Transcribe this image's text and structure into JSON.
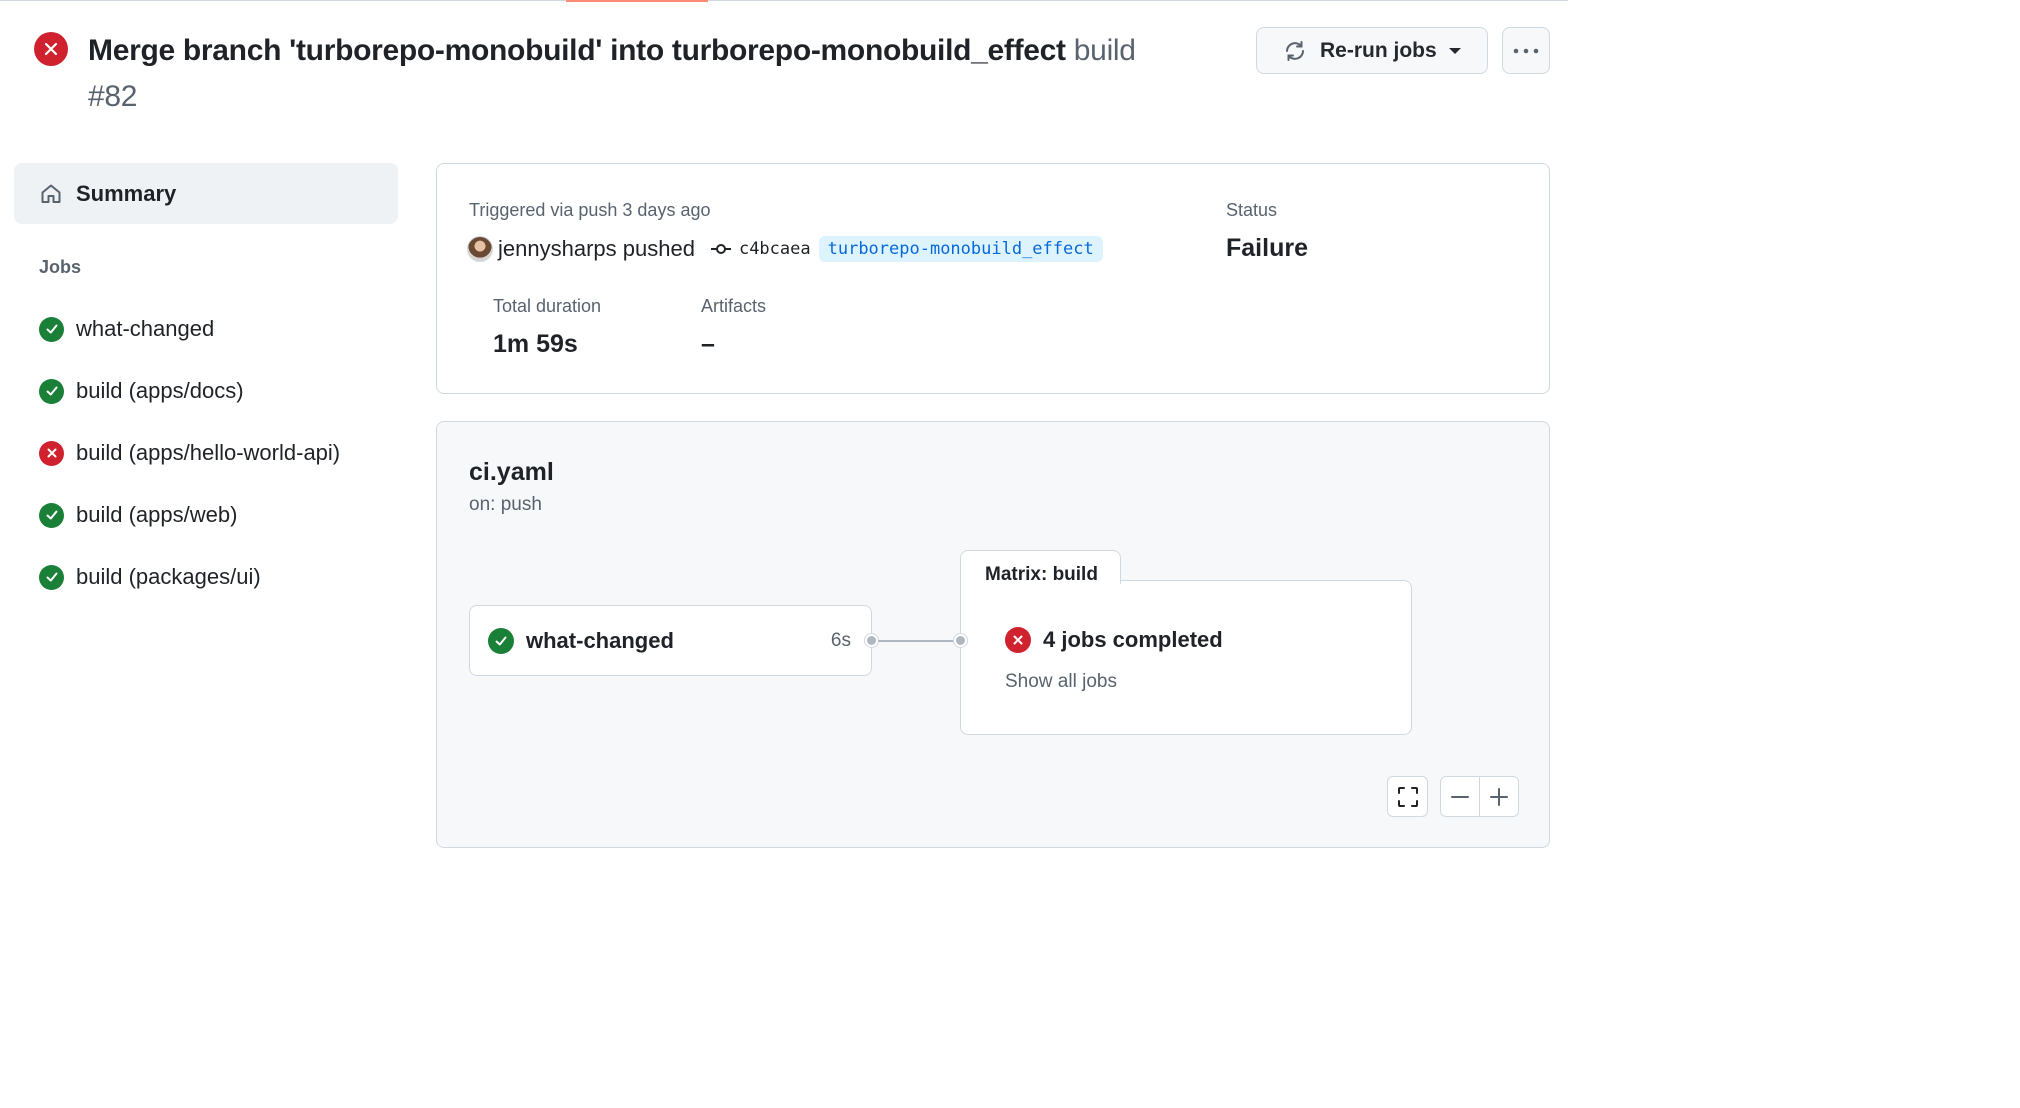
{
  "run": {
    "title": "Merge branch 'turborepo-monobuild' into turborepo-monobuild_effect",
    "workflow_word": "build",
    "run_number": "#82",
    "rerun_label": "Re-run jobs"
  },
  "sidebar": {
    "summary_label": "Summary",
    "jobs_heading": "Jobs",
    "jobs": [
      {
        "name": "what-changed",
        "status": "success"
      },
      {
        "name": "build (apps/docs)",
        "status": "success"
      },
      {
        "name": "build (apps/hello-world-api)",
        "status": "failure"
      },
      {
        "name": "build (apps/web)",
        "status": "success"
      },
      {
        "name": "build (packages/ui)",
        "status": "success"
      }
    ]
  },
  "summary": {
    "triggered_text": "Triggered via push 3 days ago",
    "pusher": "jennysharps",
    "pushed_word": "pushed",
    "commit_sha": "c4bcaea",
    "branch": "turborepo-monobuild_effect",
    "status_label": "Status",
    "status_value": "Failure",
    "duration_label": "Total duration",
    "duration_value": "1m 59s",
    "artifacts_label": "Artifacts",
    "artifacts_value": "–"
  },
  "workflow": {
    "file": "ci.yaml",
    "trigger": "on: push",
    "job_node": {
      "name": "what-changed",
      "duration": "6s",
      "status": "success"
    },
    "matrix": {
      "tab_label": "Matrix: build",
      "status_text": "4 jobs completed",
      "status": "failure",
      "show_all_label": "Show all jobs"
    }
  },
  "colors": {
    "success": "#1a7f37",
    "failure": "#cf222e",
    "link": "#0969da",
    "muted": "#59636e"
  },
  "icons": [
    "x-circle-icon",
    "sync-icon",
    "triangle-down-icon",
    "kebab-horizontal-icon",
    "home-icon",
    "check-circle-icon",
    "git-commit-icon",
    "screen-full-icon",
    "minus-icon",
    "plus-icon"
  ]
}
